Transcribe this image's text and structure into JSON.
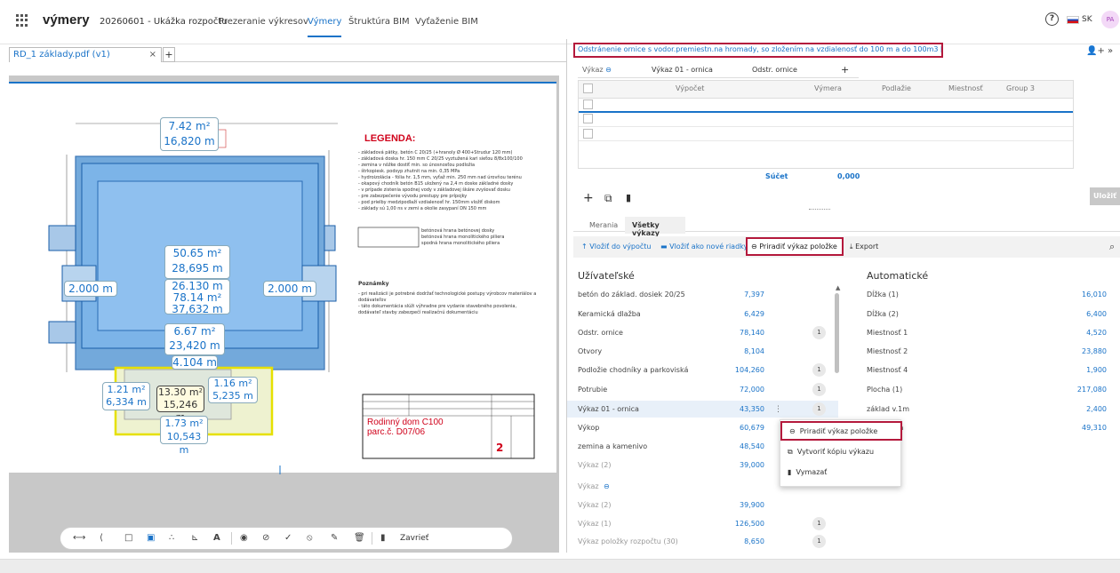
{
  "header": {
    "brand": "výmery",
    "project": "20260601 - Ukážka rozpočtu",
    "nav": [
      "Prezeranie výkresov",
      "Výmery",
      "Štruktúra BIM",
      "Vyťaženie BIM"
    ],
    "lang": "SK",
    "avatar": "PA"
  },
  "viewer": {
    "file_tab": "RD_1 základy.pdf (v1)",
    "legend_title": "LEGENDA:",
    "legend_lines": [
      "- základová pätky, betón C 20/25 (+hranoly Ø 400+Strudur 120 mm)",
      "- základová doska hr. 150 mm C 20/25 vyztužená kari sieťou 8/8x100/100",
      "- zemina v nôžke dostiť min. so únosnosťou podložia",
      "- štrkopiesk. podsyp zhutnit na min. 0,35 MPa",
      "- hydroizolácia - fólia hr. 1,5 mm, vyťaž min. 250 mm nad úrovňou terénu",
      "- okapový chodník betón B15 uložený na 2,4 m doske základné dosky",
      "- v prípade zistenia spodnej vody v základovej škáre zvyšovať dosku",
      "- pre zabezpečenie vývodu prestupy pre prípojky",
      "- pod prielby medzipodlaží vzdialenosť hr. 150mm vložiť diskom",
      "- základy sú 1,00 ns v zemi a okolie zasypaní DN 150 mm"
    ],
    "legend_keys": [
      "betónová hrana betónovej dosky",
      "betónová hrana monolitického piliera",
      "spodná hrana monolitického piliera"
    ],
    "poznamky_title": "Poznámky",
    "poznamky_lines": [
      "- pri realizácii je potrebné dodržať technologické postupy výrobcov materiálov a dodávateľov",
      "- táto dokumentácia slúži výhradne pre vydanie stavebného povolenia,",
      "  dodávateľ stavby zabezpečí realizačnú dokumentáciu"
    ],
    "stamp_title": "Rodinný dom C100",
    "stamp_sub": "parc.č. D07/06",
    "stamp_num": "2",
    "areas": [
      {
        "area": "7.42 m²",
        "perim": "16,820 m"
      },
      {
        "area": "50.65 m²",
        "perim": "28,695 m"
      },
      {
        "area": "26.130 m",
        "perim": "78.14 m²"
      },
      {
        "area": "37,632 m",
        "perim": ""
      },
      {
        "area": "6.67 m²",
        "perim": "23,420 m"
      },
      {
        "area": "1.21 m²",
        "perim": "6,334 m"
      },
      {
        "area": "13.30 m²",
        "perim": "15,246 m"
      },
      {
        "area": "1.16 m²",
        "perim": "5,235 m"
      },
      {
        "area": "1.73 m²",
        "perim": "10,543 m"
      }
    ],
    "side_left": "2.000 m",
    "side_right": "2.000 m",
    "bottom_dim": "4.104 m",
    "toolbar_close": "Zavrieť"
  },
  "right": {
    "title": "Odstránenie ornice s vodor.premiestn.na hromady, so zložením na vzdialenosť do 100 m a do 100m3  [m3]",
    "tabs": [
      "Výkaz",
      "Výkaz 01 - ornica",
      "Odstr. ornice"
    ],
    "columns": [
      "Výpočet",
      "Výmera",
      "Podlažie",
      "Miestnosť",
      "Group 3"
    ],
    "sum_label": "Súčet",
    "sum_value": "0,000",
    "save": "Uložiť",
    "lower_tabs": [
      "Merania",
      "Všetky výkazy"
    ],
    "actions": [
      "Vložiť do výpočtu",
      "Vložiť ako nové riadky",
      "Priradiť výkaz položke",
      "Export"
    ],
    "user_title": "Užívateľské",
    "auto_title": "Automatické",
    "user_items": [
      {
        "name": "betón do základ. dosiek 20/25",
        "value": "7,397",
        "badge": ""
      },
      {
        "name": "Keramická dlažba",
        "value": "6,429",
        "badge": ""
      },
      {
        "name": "Odstr. ornice",
        "value": "78,140",
        "badge": "1"
      },
      {
        "name": "Otvory",
        "value": "8,104",
        "badge": ""
      },
      {
        "name": "Podložie chodníky a parkoviská",
        "value": "104,260",
        "badge": "1"
      },
      {
        "name": "Potrubie",
        "value": "72,000",
        "badge": "1"
      },
      {
        "name": "Výkaz 01 - ornica",
        "value": "43,350",
        "badge": "1"
      },
      {
        "name": "Výkop",
        "value": "60,679",
        "badge": ""
      },
      {
        "name": "zemina a kamenivo",
        "value": "48,540",
        "badge": ""
      },
      {
        "name": "Výkaz (2)",
        "value": "39,000",
        "badge": ""
      },
      {
        "name": "Výkaz",
        "value": "",
        "badge": ""
      },
      {
        "name": "Výkaz (2)",
        "value": "39,900",
        "badge": ""
      },
      {
        "name": "Výkaz (1)",
        "value": "126,500",
        "badge": "1"
      },
      {
        "name": "Výkaz položky rozpočtu (30)",
        "value": "8,650",
        "badge": "1"
      }
    ],
    "auto_items": [
      {
        "name": "Dĺžka (1)",
        "value": "16,010"
      },
      {
        "name": "Dĺžka (2)",
        "value": "6,400"
      },
      {
        "name": "Miestnosť 1",
        "value": "4,520"
      },
      {
        "name": "Miestnosť 2",
        "value": "23,880"
      },
      {
        "name": "Miestnosť 4",
        "value": "1,900"
      },
      {
        "name": "Plocha (1)",
        "value": "217,080"
      },
      {
        "name": "základ v.1m",
        "value": "2,400"
      },
      {
        "name": "ka",
        "value": "49,310"
      }
    ],
    "ctx_menu": [
      "Priradiť výkaz položke",
      "Vytvoriť kópiu výkazu",
      "Vymazať"
    ]
  }
}
